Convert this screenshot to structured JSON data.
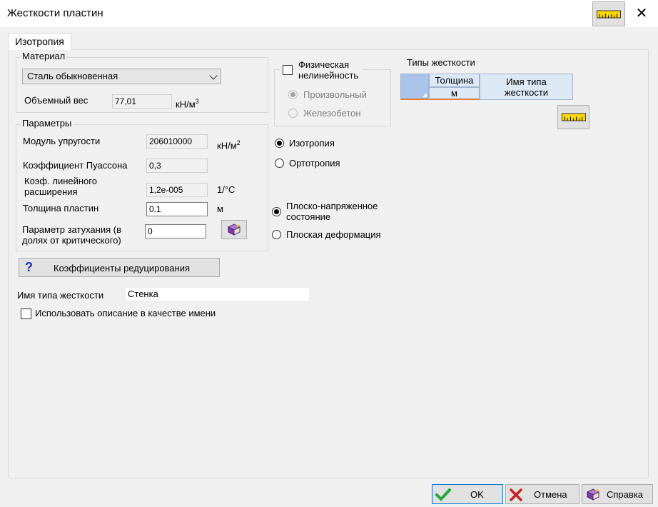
{
  "window": {
    "title": "Жесткости пластин",
    "close_glyph": "✕"
  },
  "tabs": [
    {
      "label": "Изотропия"
    }
  ],
  "material": {
    "legend": "Материал",
    "selected": "Сталь обыкновенная",
    "volume_weight_label": "Объемный вес",
    "volume_weight_value": "77,01",
    "volume_weight_unit": "кН/м",
    "volume_weight_unit_exp": "3"
  },
  "nonlinearity": {
    "label_line1": "Физическая",
    "label_line2": "нелинейность",
    "option_arbitrary": "Произвольный",
    "option_concrete": "Железобетон"
  },
  "parameters": {
    "legend": "Параметры",
    "elastic_modulus_label": "Модуль упругости",
    "elastic_modulus_value": "206010000",
    "elastic_modulus_unit": "кН/м",
    "elastic_modulus_unit_exp": "2",
    "poisson_label": "Коэффициент Пуассона",
    "poisson_value": "0,3",
    "expansion_label_line1": "Коэф. линейного",
    "expansion_label_line2": "расширения",
    "expansion_value": "1,2e-005",
    "expansion_unit": "1/°C",
    "thickness_label": "Толщина пластин",
    "thickness_value": "0.1",
    "thickness_unit": "м",
    "damping_label_line1": "Параметр затухания (в",
    "damping_label_line2": "долях от критического)",
    "damping_value": "0"
  },
  "anisotropy": {
    "isotropy": "Изотропия",
    "orthotropy": "Ортотропия"
  },
  "stress_state": {
    "plane_stress_line1": "Плоско-напряженное",
    "plane_stress_line2": "состояние",
    "plane_strain": "Плоская деформация"
  },
  "reduction_button": {
    "icon": "?",
    "label": "Коэффициенты редуцирования"
  },
  "stiffness_name": {
    "label": "Имя типа жесткости",
    "value": "Стенка"
  },
  "use_description": {
    "label": "Использовать описание в качестве имени"
  },
  "stiffness_types": {
    "title": "Типы жесткости",
    "columns": [
      {
        "header": "Толщина",
        "unit": "м"
      },
      {
        "header_line1": "Имя типа",
        "header_line2": "жесткости"
      }
    ]
  },
  "footer": {
    "ok": "OK",
    "cancel": "Отмена",
    "help": "Справка"
  },
  "colors": {
    "ruler_yellow": "#ffd800",
    "ok_green": "#22a83a",
    "cancel_red": "#c81e1e",
    "grid_blue": "#dde8f5"
  }
}
